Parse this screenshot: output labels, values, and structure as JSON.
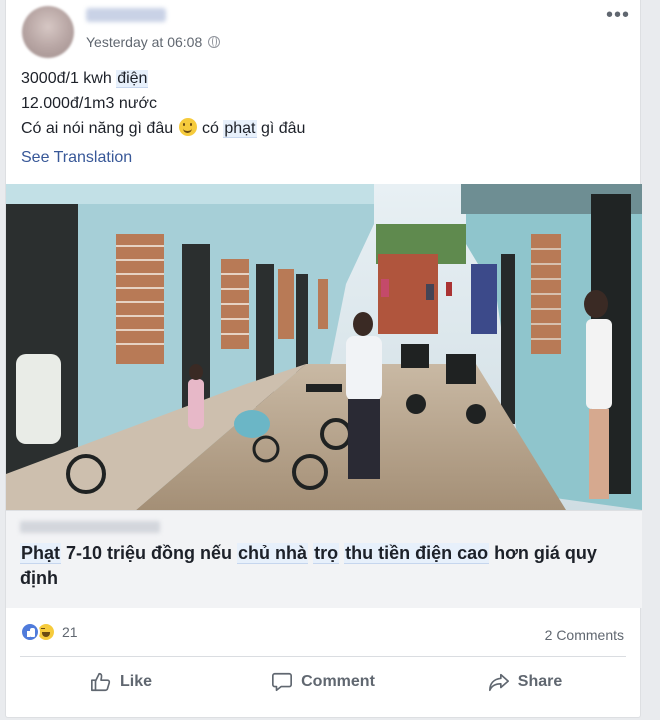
{
  "post": {
    "timestamp": "Yesterday at 06:08",
    "lines": [
      "3000đ/1 kwh ",
      "điện",
      "12.000đ/1m3 nước",
      "Có ai nói năng gì đâu ",
      " có ",
      "phạt",
      " gì đâu"
    ],
    "see_translation": "See Translation"
  },
  "link": {
    "title_parts": [
      "Phạt",
      " 7-10 triệu đồng nếu ",
      "chủ nhà",
      " ",
      "trọ",
      " ",
      "thu tiền điện cao",
      " hơn giá quy định"
    ]
  },
  "reactions": {
    "count": "21",
    "comments": "2 Comments"
  },
  "actions": {
    "like": "Like",
    "comment": "Comment",
    "share": "Share"
  },
  "icons": [
    "more-icon",
    "globe-icon",
    "smile-icon",
    "like-reaction-icon",
    "haha-reaction-icon",
    "like-icon",
    "comment-icon",
    "share-icon"
  ]
}
